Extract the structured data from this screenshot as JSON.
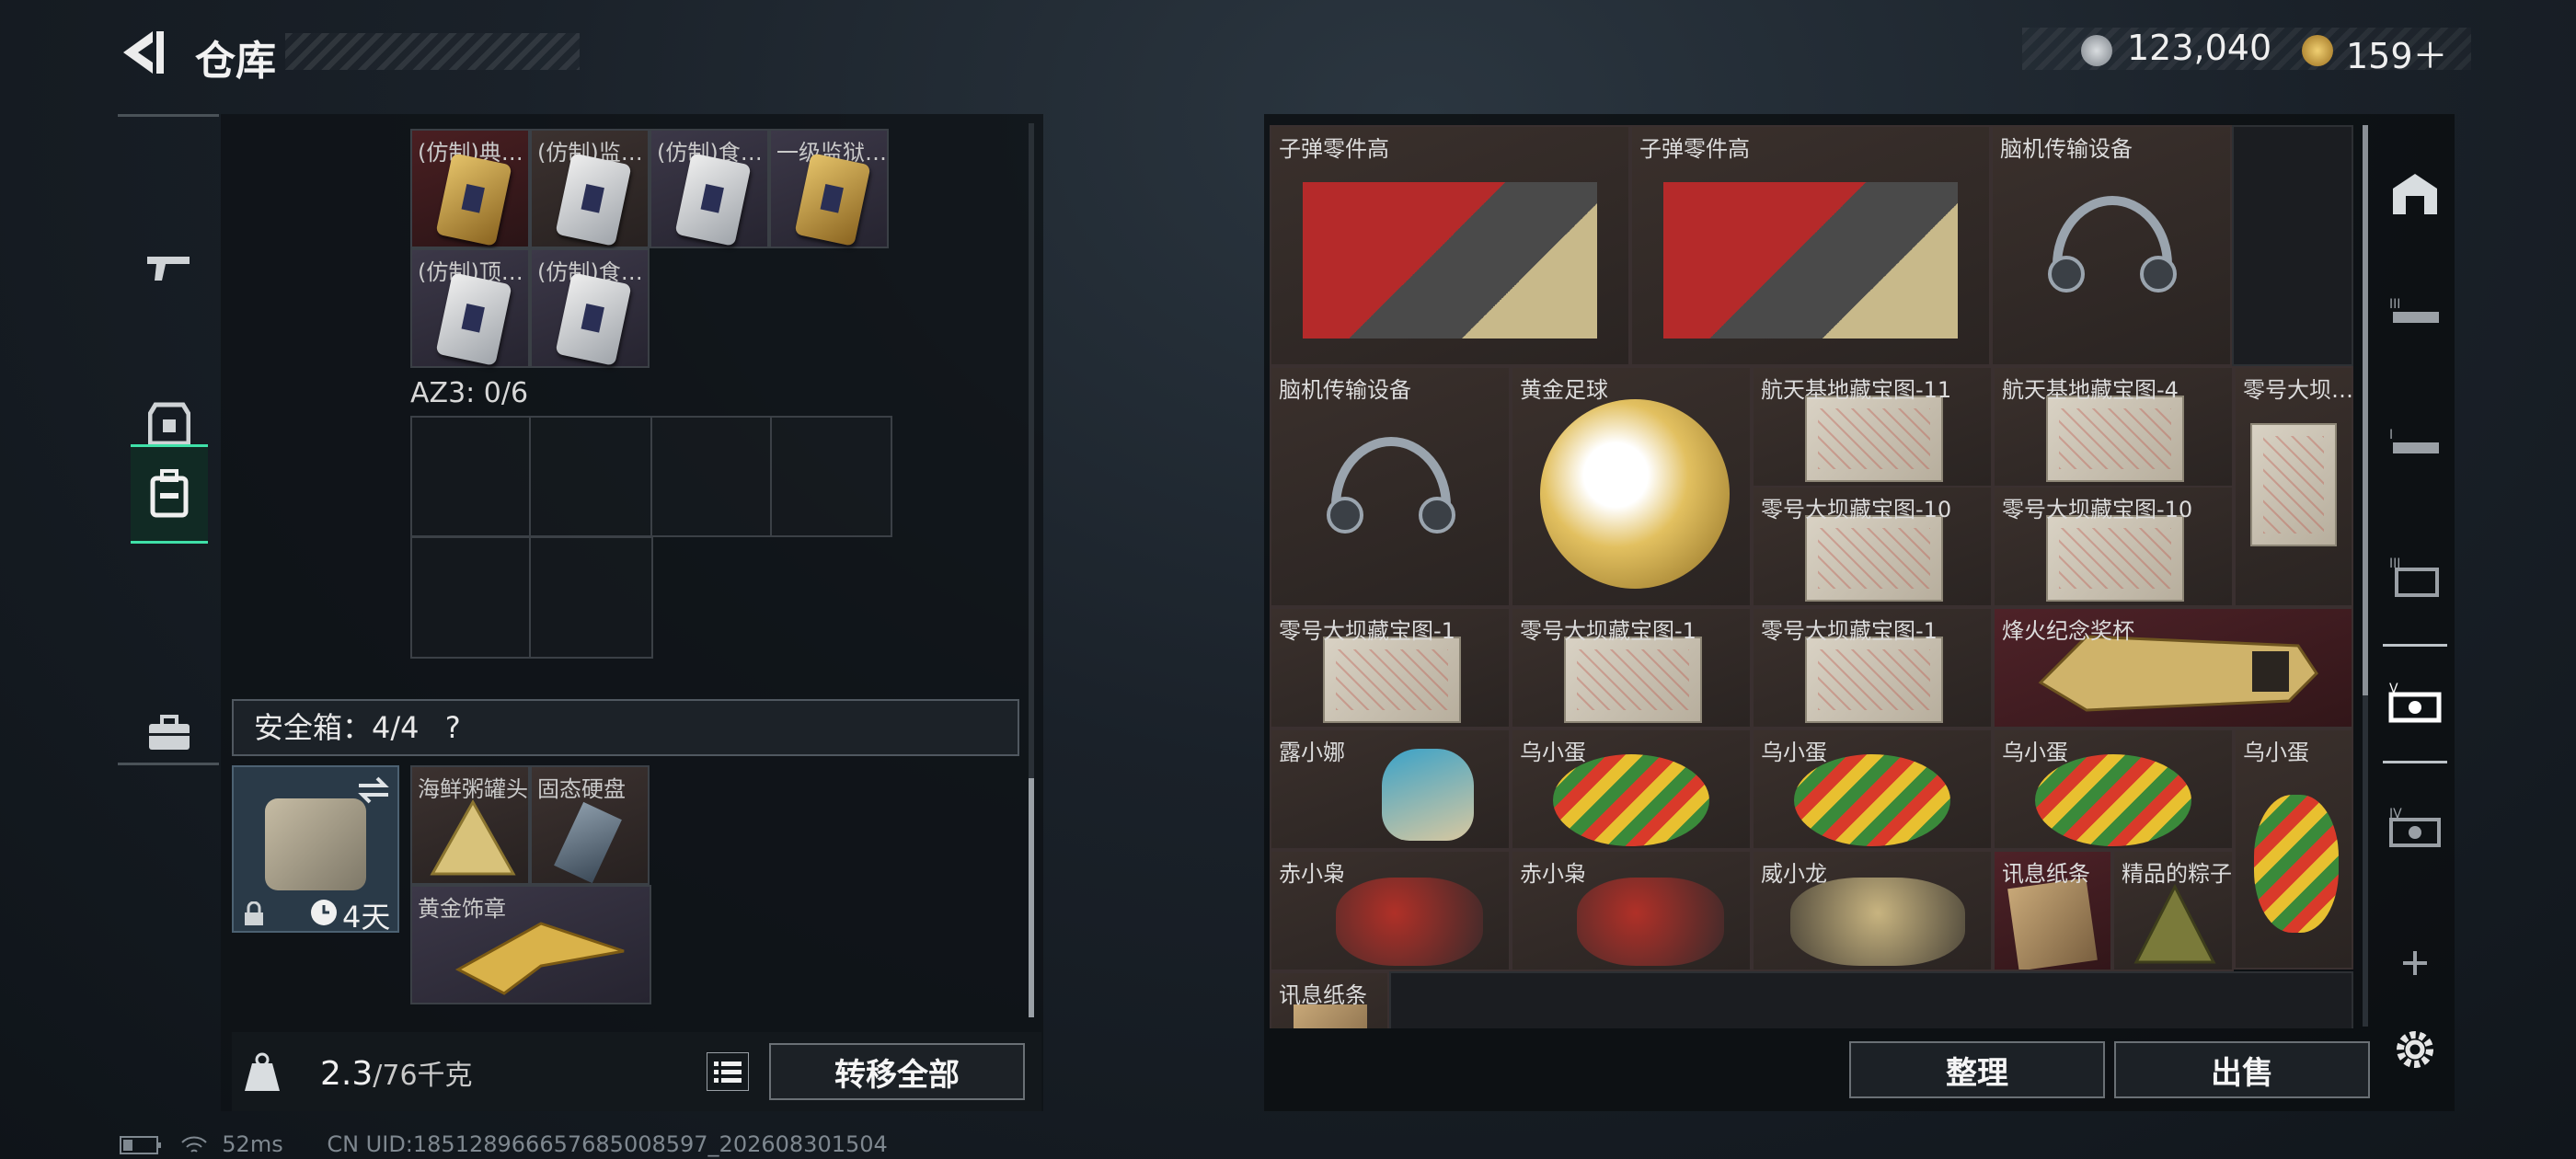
{
  "header": {
    "title": "仓库"
  },
  "currency": [
    {
      "icon": "silver-coin-icon",
      "value": "123,040"
    },
    {
      "icon": "gold-coin-icon",
      "value": "159＋"
    }
  ],
  "left_nav": [
    {
      "icon": "gun-icon"
    },
    {
      "icon": "armor-icon"
    },
    {
      "icon": "backpack-icon"
    },
    {
      "icon": "briefcase-icon"
    }
  ],
  "left_items": [
    "(仿制)典…",
    "(仿制)监…",
    "(仿制)食…",
    "一级监狱…",
    "(仿制)顶…",
    "(仿制)食…"
  ],
  "az3": {
    "label": "AZ3: 0/6"
  },
  "safebox": {
    "label": "安全箱：4/4",
    "help": "?",
    "timer": "4天"
  },
  "safebox_items": [
    "海鲜粥罐头",
    "固态硬盘",
    "黄金饰章"
  ],
  "weight": {
    "current": "2.3",
    "max": "/76千克"
  },
  "buttons": {
    "transfer_all": "转移全部",
    "sort": "整理",
    "sell": "出售"
  },
  "grid_items": [
    "子弹零件高",
    "子弹零件高",
    "脑机传输设备",
    "脑机传输设备",
    "黄金足球",
    "航天基地藏宝图-11",
    "航天基地藏宝图-4",
    "零号大坝…",
    "零号大坝藏宝图-10",
    "零号大坝藏宝图-10",
    "零号大坝藏宝图-1",
    "零号大坝藏宝图-1",
    "零号大坝藏宝图-1",
    "烽火纪念奖杯",
    "露小娜",
    "乌小蛋",
    "乌小蛋",
    "乌小蛋",
    "乌小蛋",
    "赤小枭",
    "赤小枭",
    "威小龙",
    "讯息纸条",
    "精品的粽子",
    "讯息纸条"
  ],
  "status": {
    "ping": "52ms",
    "uid": "CN UID:185128966657685008597_202608301504"
  },
  "colors": {
    "accent_green": "#3fe0a8",
    "rarity_red": "#4e2228",
    "rarity_gold": "#e5c36a"
  }
}
